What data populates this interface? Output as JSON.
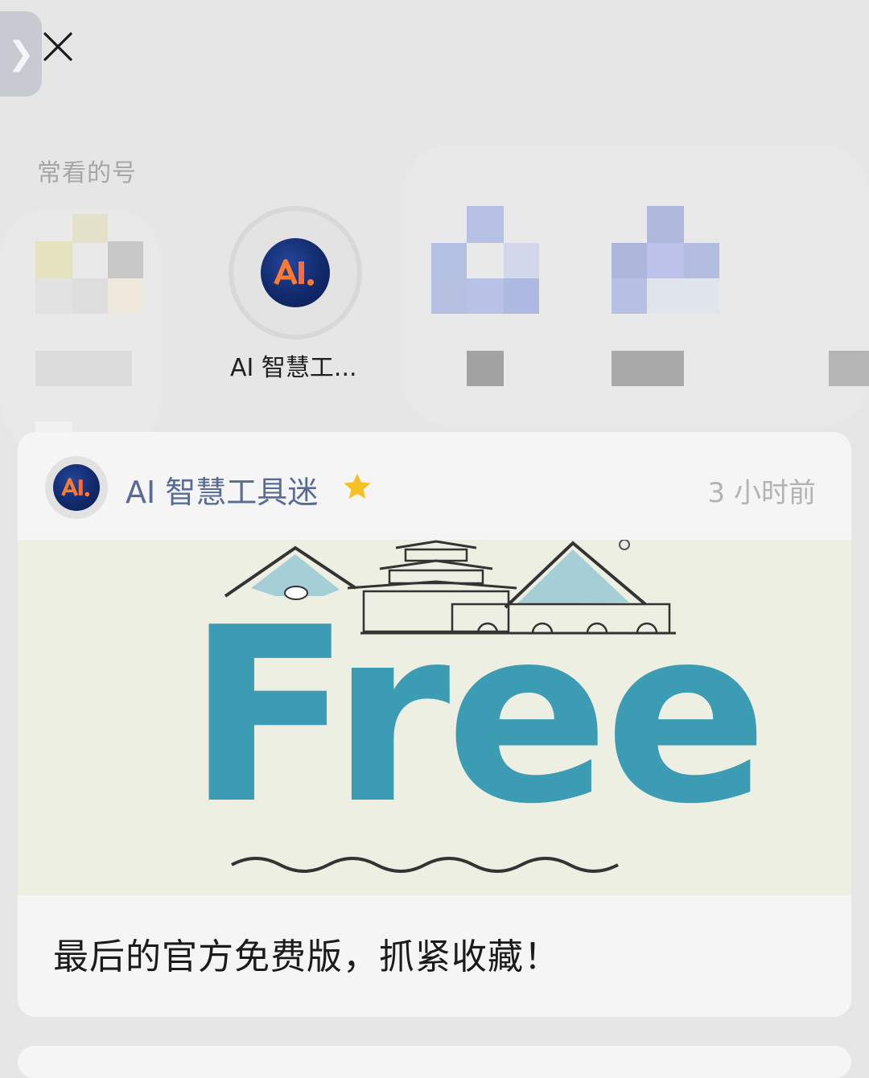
{
  "side_tab": {
    "glyph": "❯"
  },
  "section": {
    "title": "常看的号"
  },
  "frequent": [
    {
      "name": "AI 智慧工..."
    }
  ],
  "post": {
    "author": "AI 智慧工具迷",
    "time": "3 小时前",
    "cover_text": "Free",
    "caption": "最后的官方免费版，抓紧收藏！"
  },
  "colors": {
    "link": "#576b95",
    "accent_star": "#f7c024",
    "logo_bg": "#122a6c",
    "logo_fg": "#ff7a2e",
    "cover_text": "#3c9cb3"
  },
  "icons": [
    "chevron-right-icon",
    "close-icon",
    "star-icon",
    "ai-logo-icon"
  ]
}
